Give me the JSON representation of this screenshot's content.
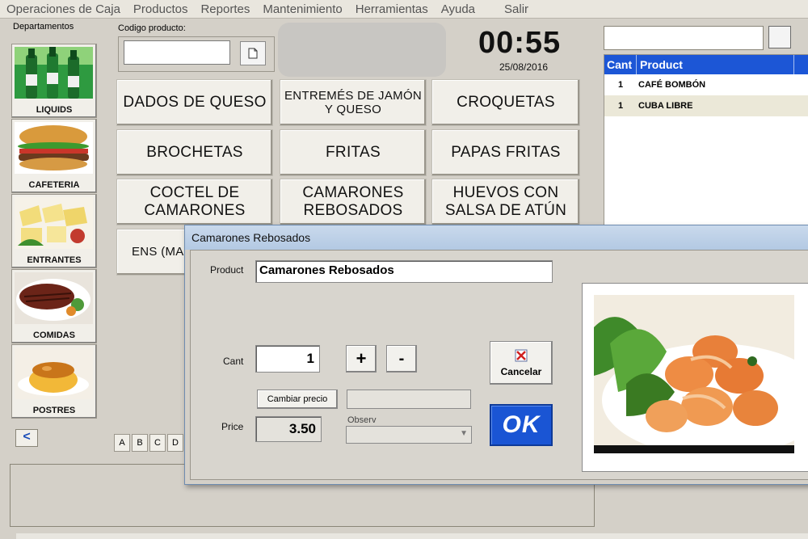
{
  "menu": [
    "Operaciones de Caja",
    "Productos",
    "Reportes",
    "Mantenimiento",
    "Herramientas",
    "Ayuda",
    "Salir"
  ],
  "departments_label": "Departamentos",
  "departments": [
    "LIQUIDS",
    "CAFETERIA",
    "ENTRANTES",
    "COMIDAS",
    "POSTRES"
  ],
  "nav_back": "<",
  "code_label": "Codigo producto:",
  "code_value": "",
  "clock": "00:55",
  "date": "25/08/2016",
  "products": {
    "p1": "DADOS DE QUESO",
    "p2": "ENTREMÉS DE JAMÓN Y QUESO",
    "p3": "CROQUETAS",
    "p4": "BROCHETAS",
    "p5": "FRITAS",
    "p6": "PAPAS FRITAS",
    "p7": "COCTEL DE CAMARONES",
    "p8": "CAMARONES REBOSADOS",
    "p9": "HUEVOS CON SALSA DE ATÚN",
    "p10": "ENS (MACED"
  },
  "alphabet": [
    "A",
    "B",
    "C",
    "D"
  ],
  "order": {
    "col_cant": "Cant",
    "col_product": "Product",
    "rows": [
      {
        "cant": "1",
        "product": "CAFÉ BOMBÓN"
      },
      {
        "cant": "1",
        "product": "CUBA LIBRE"
      }
    ]
  },
  "dialog": {
    "title": "Camarones Rebosados",
    "product_label": "Product",
    "product_value": "Camarones Rebosados",
    "cant_label": "Cant",
    "cant_value": "1",
    "plus_label": "+",
    "minus_label": "-",
    "change_price_label": "Cambiar precio",
    "price_label": "Price",
    "price_value": "3.50",
    "observ_label": "Observ",
    "cancel_label": "Cancelar",
    "ok_label": "OK"
  },
  "colors": {
    "accent": "#1c56d6",
    "ok_button": "#1a55d4",
    "row_alt": "#ebe8d8"
  }
}
